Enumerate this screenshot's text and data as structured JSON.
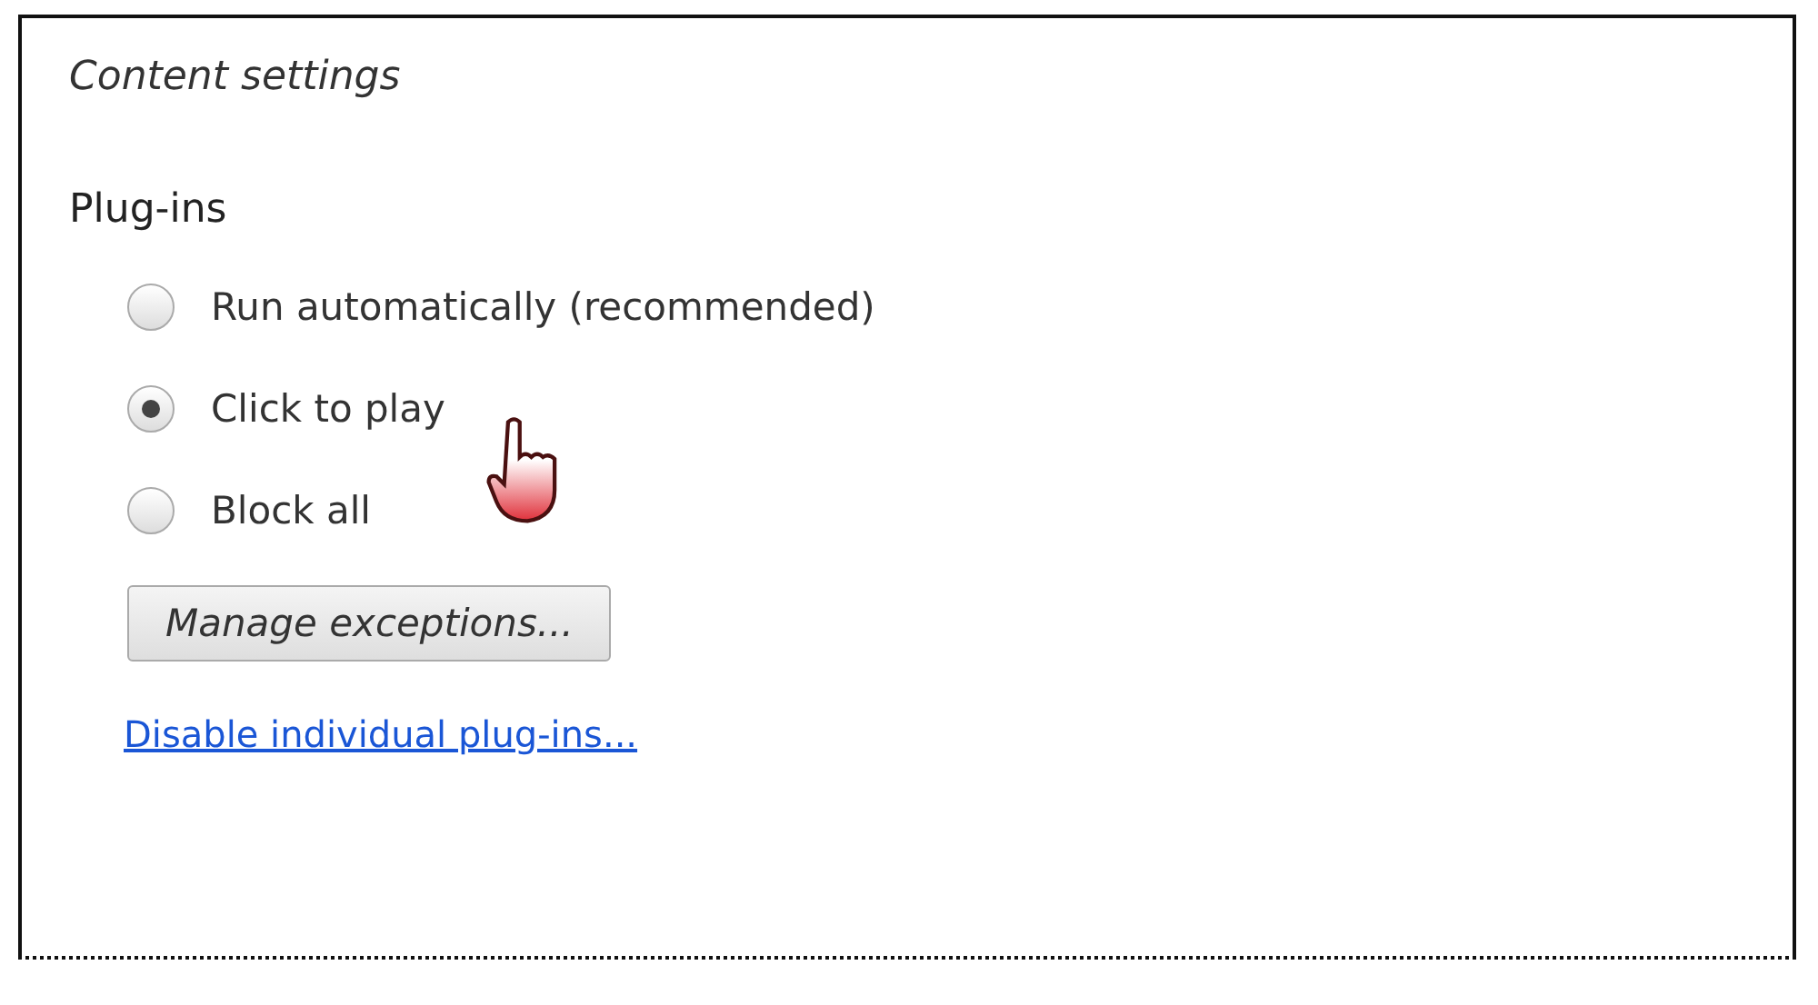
{
  "title": "Content settings",
  "section": {
    "heading": "Plug-ins",
    "options": [
      {
        "label": "Run automatically (recommended)",
        "selected": false
      },
      {
        "label": "Click to play",
        "selected": true
      },
      {
        "label": "Block all",
        "selected": false
      }
    ],
    "button": "Manage exceptions...",
    "link": "Disable individual plug-ins..."
  }
}
